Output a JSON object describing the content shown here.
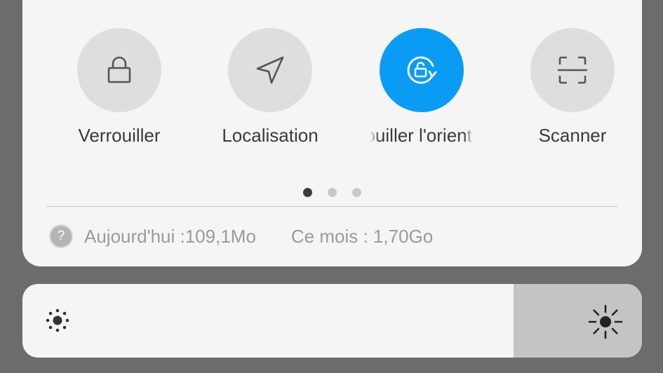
{
  "tiles": [
    {
      "label": "Verrouiller",
      "icon": "lock-icon",
      "active": false
    },
    {
      "label": "Localisation",
      "icon": "location-arrow-icon",
      "active": false
    },
    {
      "label": "Verrouiller l'orientation",
      "visible_label": "uiller l'orientatio",
      "icon": "rotation-lock-icon",
      "active": true
    },
    {
      "label": "Scanner",
      "icon": "scan-icon",
      "active": false
    }
  ],
  "pager": {
    "count": 3,
    "current": 0
  },
  "usage": {
    "icon": "help-icon",
    "icon_glyph": "?",
    "today": "Aujourd'hui :109,1Mo",
    "month": "Ce mois : 1,70Go"
  },
  "brightness": {
    "level": 0.78,
    "low_icon": "brightness-low-icon",
    "high_icon": "brightness-high-icon"
  },
  "colors": {
    "accent": "#0a9cf5",
    "tile_inactive": "#dedede",
    "card": "#f5f5f5",
    "scrim": "#6c6c6c"
  }
}
